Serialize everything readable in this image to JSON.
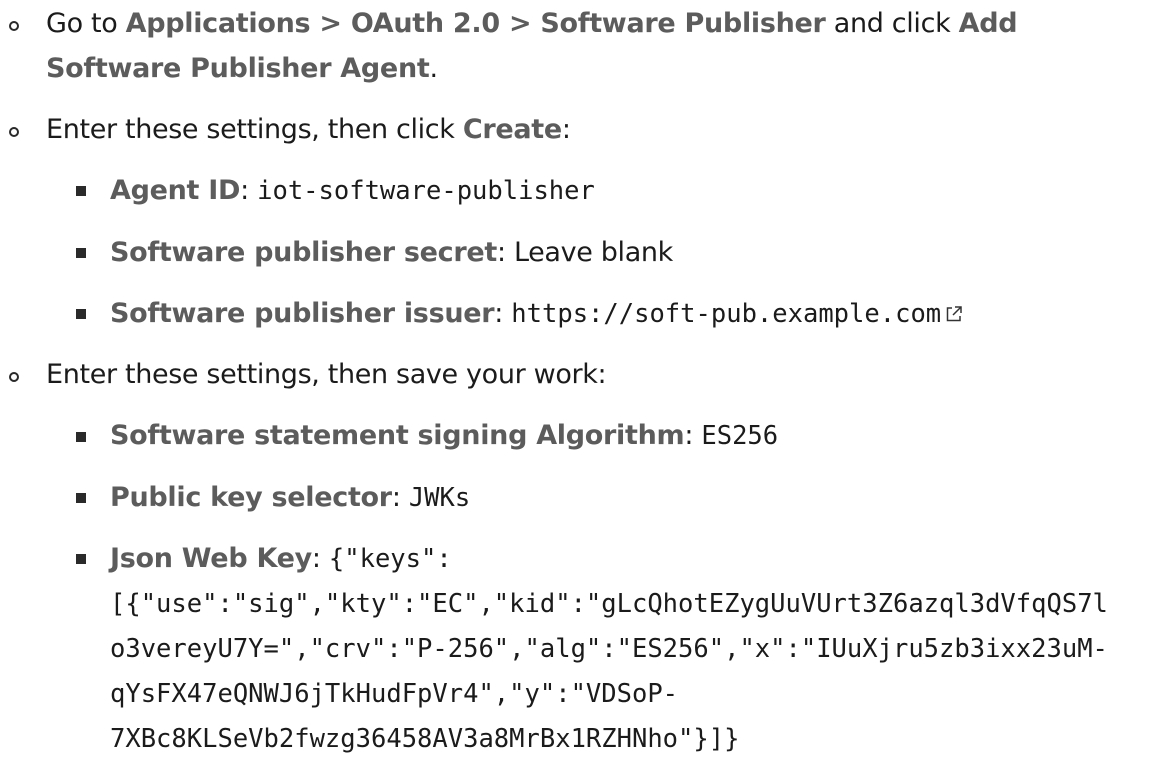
{
  "steps": [
    {
      "parts": [
        "Go to ",
        "Applications > OAuth 2.0 > Software Publisher",
        " and click ",
        "Add"
      ],
      "line2": [
        "Software Publisher Agent",
        "."
      ]
    },
    {
      "parts": [
        "Enter these settings, then click ",
        "Create",
        ":"
      ],
      "settings": [
        {
          "label": "Agent ID",
          "sep": ": ",
          "value": "iot-software-publisher"
        },
        {
          "label": "Software publisher secret",
          "sep": ": ",
          "value": "Leave blank"
        },
        {
          "label": "Software publisher issuer",
          "sep": ": ",
          "value": "https://soft-pub.example.com",
          "icon": "external-link-icon"
        }
      ]
    },
    {
      "parts": [
        "Enter these settings, then save your work:"
      ],
      "settings": [
        {
          "label": "Software statement signing Algorithm",
          "sep": ": ",
          "value": "ES256"
        },
        {
          "label": "Public key selector",
          "sep": ": ",
          "value": "JWKs"
        },
        {
          "label": "Json Web Key",
          "sep": ": ",
          "value_lines": [
            "{\"keys\":",
            "[{\"use\":\"sig\",\"kty\":\"EC\",\"kid\":\"gLcQhotEZygUuVUrt3Z6azql3dVfqQS7l",
            "o3vereyU7Y=\",\"crv\":\"P-256\",\"alg\":\"ES256\",\"x\":\"IUuXjru5zb3ixx23uM-",
            "qYsFX47eQNWJ6jTkHudFpVr4\",\"y\":\"VDSoP-",
            "7XBc8KLSeVb2fwzg36458AV3a8MrBx1RZHNho\"}]}"
          ]
        }
      ]
    }
  ]
}
